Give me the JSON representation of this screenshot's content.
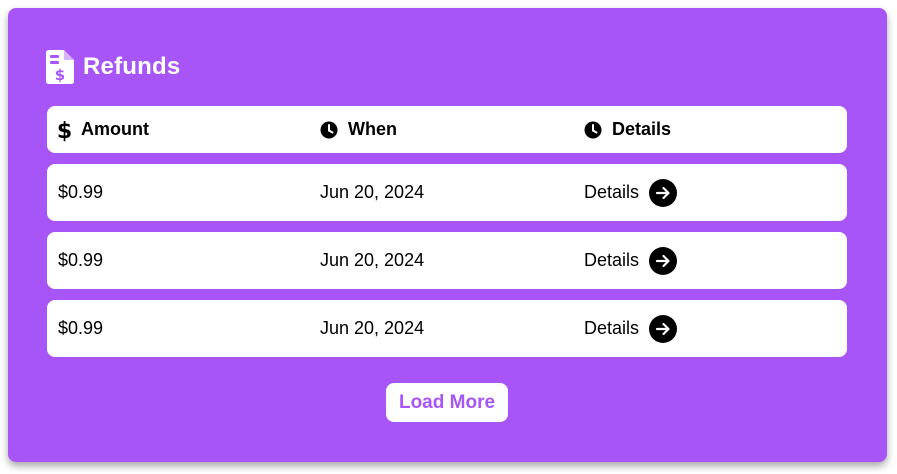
{
  "panel": {
    "title": "Refunds",
    "title_icon": "receipt-dollar-icon",
    "accent_color": "#a855f7"
  },
  "table": {
    "columns": [
      {
        "label": "Amount",
        "icon": "dollar-icon"
      },
      {
        "label": "When",
        "icon": "clock-icon"
      },
      {
        "label": "Details",
        "icon": "clock-icon"
      }
    ],
    "rows": [
      {
        "amount": "$0.99",
        "when": "Jun 20, 2024",
        "details_label": "Details",
        "details_icon": "arrow-right-circle-icon"
      },
      {
        "amount": "$0.99",
        "when": "Jun 20, 2024",
        "details_label": "Details",
        "details_icon": "arrow-right-circle-icon"
      },
      {
        "amount": "$0.99",
        "when": "Jun 20, 2024",
        "details_label": "Details",
        "details_icon": "arrow-right-circle-icon"
      }
    ]
  },
  "actions": {
    "load_more_label": "Load More"
  }
}
